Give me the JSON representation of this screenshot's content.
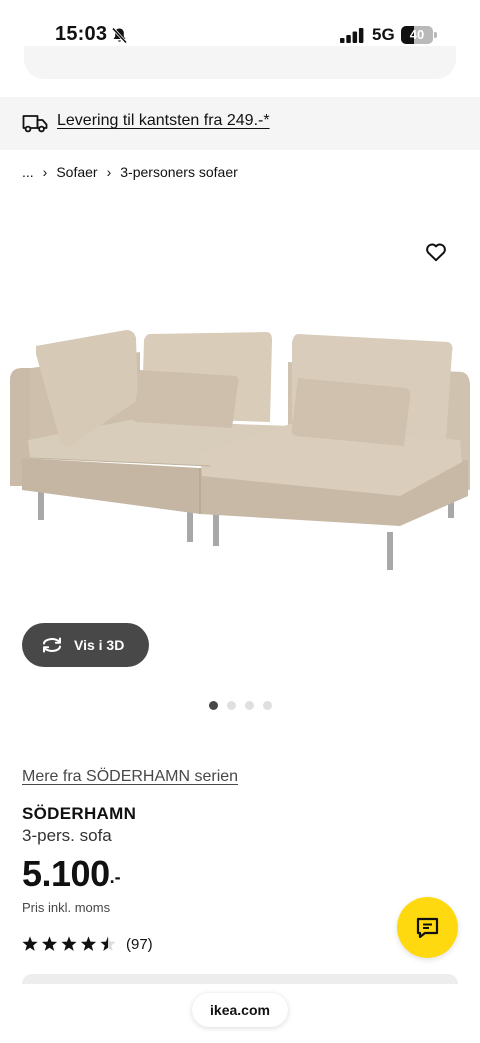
{
  "status_bar": {
    "time": "15:03",
    "network": "5G",
    "battery_percent": 40
  },
  "delivery_banner": {
    "text": "Levering til kantsten fra 249.-*"
  },
  "breadcrumb": [
    {
      "label": "..."
    },
    {
      "label": "Sofaer"
    },
    {
      "label": "3-personers sofaer"
    }
  ],
  "breadcrumb_separator": "›",
  "gallery": {
    "view_3d_label": "Vis i 3D",
    "slide_count": 4,
    "active_slide": 1
  },
  "product": {
    "series_link": "Mere fra SÖDERHAMN serien",
    "name": "SÖDERHAMN",
    "type": "3-pers. sofa",
    "price": "5.100",
    "price_suffix": ".-",
    "price_note": "Pris inkl. moms",
    "rating": 4.5,
    "rating_max": 5,
    "review_count": "(97)"
  },
  "browser": {
    "url": "ikea.com"
  },
  "colors": {
    "accent_yellow": "#ffd90f",
    "dark_button": "#484848",
    "banner_bg": "#f5f5f5",
    "sofa_fabric": "#d4c7b4"
  },
  "icons": {
    "bell": "bell-slash-icon",
    "delivery": "truck-icon",
    "favorite": "heart-icon",
    "view_3d": "rotate-icon",
    "chat": "chat-icon"
  }
}
